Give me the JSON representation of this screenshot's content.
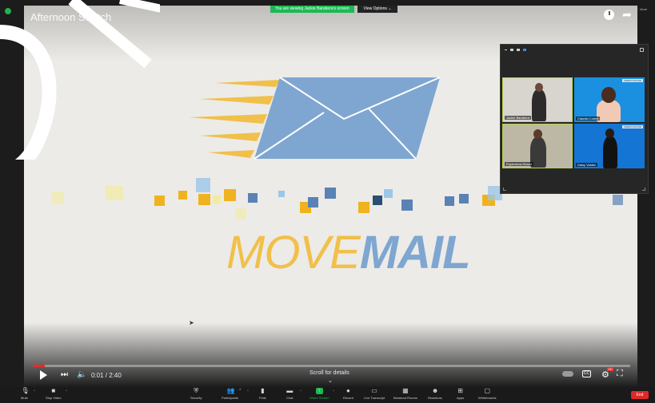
{
  "video": {
    "title": "Afternoon Stretch",
    "time": "0:01 / 2:40",
    "scroll_hint": "Scroll for details",
    "progress": 0.012
  },
  "banner": {
    "message": "You are viewing Jackie Barabera's screen",
    "options": "View Options ⌄"
  },
  "more_label": "⋮ More",
  "logo": {
    "word_move": "MOVE",
    "word_mail": "MAIL"
  },
  "gallery": {
    "participants": [
      {
        "name": "Jackie Barabera",
        "tag": ""
      },
      {
        "name": "Claudia Cortez",
        "tag": "AMERICAROSE"
      },
      {
        "name": "Esperanza Munoz",
        "tag": ""
      },
      {
        "name": "Daisy Valdez",
        "tag": "AMERICAROSE"
      }
    ]
  },
  "toolbar": {
    "mute": "Mute",
    "stop_video": "Stop Video",
    "security": "Security",
    "participants": "Participants",
    "participants_count": "4",
    "polls": "Polls",
    "chat": "Chat",
    "share_screen": "Share Screen",
    "record": "Record",
    "live_transcript": "Live Transcript",
    "breakout_rooms": "Breakout Rooms",
    "reactions": "Reactions",
    "apps": "Apps",
    "whiteboards": "Whiteboards",
    "end": "End"
  },
  "colors": {
    "zoom_green": "#1db954",
    "end_red": "#e02828",
    "logo_yellow": "#f1c04a",
    "logo_blue": "#7ea6d0"
  }
}
